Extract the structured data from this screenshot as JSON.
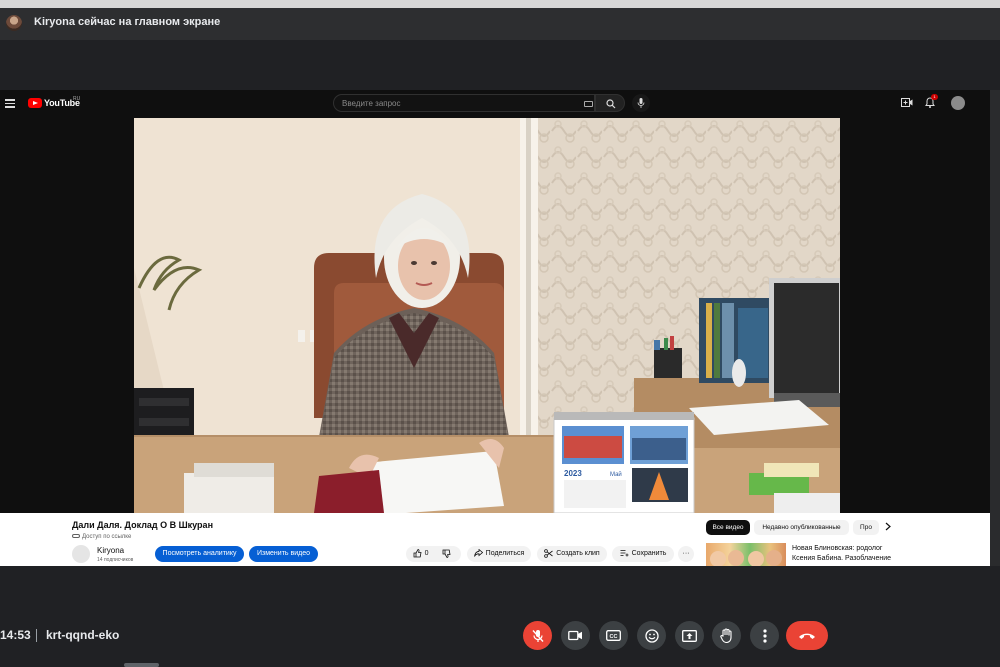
{
  "meet": {
    "presenter_banner": "Kiryona сейчас на главном экране",
    "time": "14:53",
    "meeting_code": "krt-qqnd-eko",
    "controls": [
      {
        "name": "mic-off",
        "icon": "mic-off-icon",
        "color": "#ea4335"
      },
      {
        "name": "camera",
        "icon": "videocam-icon"
      },
      {
        "name": "captions",
        "icon": "closed-captions-icon",
        "text": "CC"
      },
      {
        "name": "reactions",
        "icon": "emoji-icon"
      },
      {
        "name": "present",
        "icon": "present-screen-icon"
      },
      {
        "name": "raise-hand",
        "icon": "hand-icon"
      },
      {
        "name": "more",
        "icon": "more-vert-icon"
      },
      {
        "name": "hang-up",
        "icon": "call-end-icon",
        "color": "#ea4335"
      }
    ]
  },
  "youtube": {
    "logo": "YouTube",
    "region": "RU",
    "search_placeholder": "Введите запрос",
    "bell_badge": "1",
    "video": {
      "title": "Дали Даля. Доклад О В Шкуран",
      "visibility": "Доступ по ссылке",
      "channel_name": "Kiryona",
      "subscribers": "14 подписчиков",
      "likes": "0",
      "buttons": {
        "analytics": "Посмотреть аналитику",
        "edit": "Изменить видео",
        "share": "Поделиться",
        "clip": "Создать клип",
        "save": "Сохранить",
        "more": "···"
      }
    },
    "chips": [
      "Все видео",
      "Недавно опубликованные",
      "Про"
    ],
    "recommendation": {
      "title": "Новая Блиновская: родолог Ксения Бабина. Разоблачение"
    },
    "calendar_year": "2023",
    "calendar_month": "Май"
  },
  "colors": {
    "meet_bg": "#202124",
    "control_bg": "#3c4043",
    "danger": "#ea4335",
    "yt_blue": "#065fd4",
    "yt_red": "#ff0000"
  }
}
